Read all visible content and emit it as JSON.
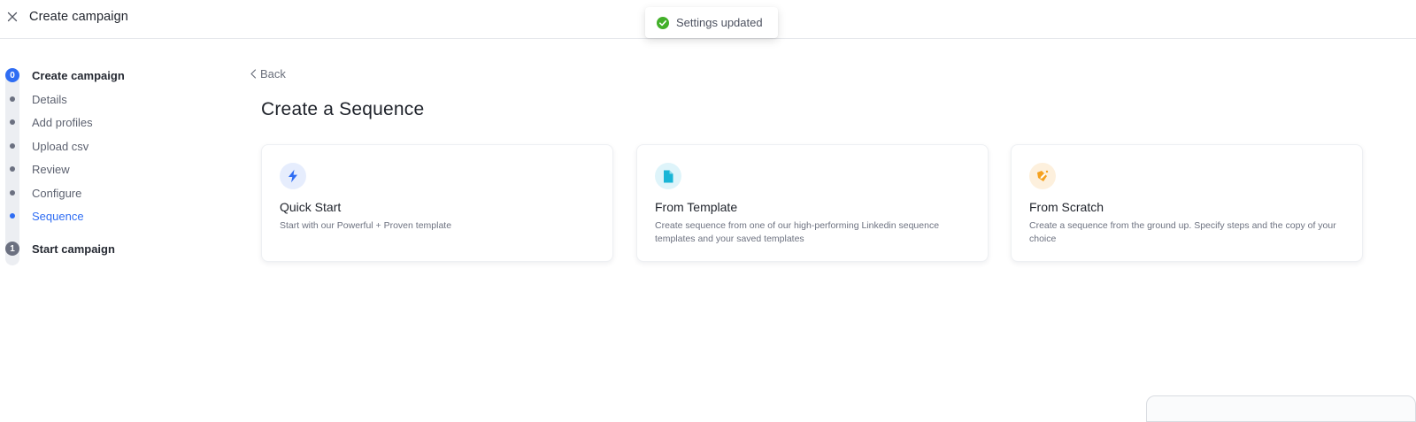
{
  "topbar": {
    "title": "Create campaign",
    "close_icon": "close-icon"
  },
  "toast": {
    "text": "Settings updated",
    "icon": "check-circle-icon",
    "color": "#43b02a"
  },
  "stepper": {
    "steps": [
      {
        "number": "0",
        "label": "Create campaign",
        "state": "active",
        "substeps": [
          {
            "label": "Details",
            "current": false
          },
          {
            "label": "Add profiles",
            "current": false
          },
          {
            "label": "Upload csv",
            "current": false
          },
          {
            "label": "Review",
            "current": false
          },
          {
            "label": "Configure",
            "current": false
          },
          {
            "label": "Sequence",
            "current": true
          }
        ]
      },
      {
        "number": "1",
        "label": "Start campaign",
        "state": "pending",
        "substeps": []
      }
    ],
    "accent": "#2f6df3"
  },
  "main": {
    "back_label": "Back",
    "title": "Create a Sequence",
    "cards": [
      {
        "title": "Quick Start",
        "description": "Start with our Powerful + Proven template",
        "icon": "lightning-icon",
        "icon_color": "#2f6df3",
        "icon_bg": "#e6edfd"
      },
      {
        "title": "From Template",
        "description": "Create sequence from one of our high-performing Linkedin sequence templates and your saved templates",
        "icon": "document-icon",
        "icon_color": "#19b5d6",
        "icon_bg": "#def4fa"
      },
      {
        "title": "From Scratch",
        "description": "Create a sequence from the ground up. Specify steps and the copy of your choice",
        "icon": "pencil-sparkle-icon",
        "icon_color": "#f5a11f",
        "icon_bg": "#fdf0dd"
      }
    ]
  }
}
